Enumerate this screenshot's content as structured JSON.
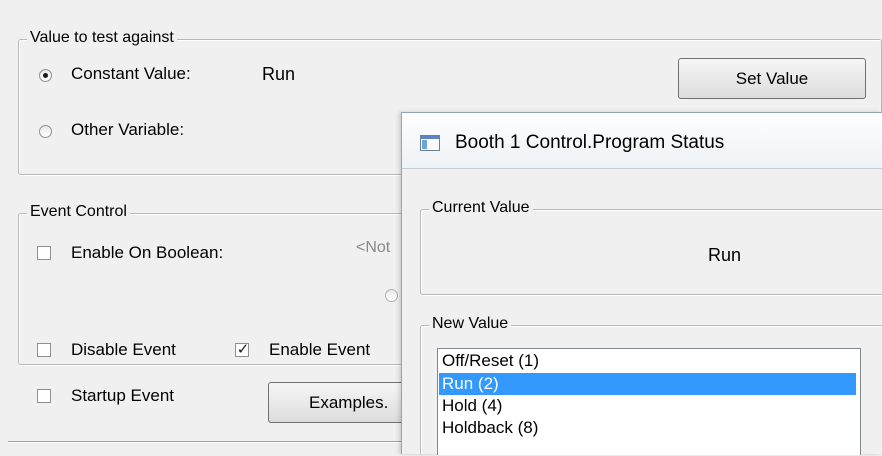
{
  "test_group": {
    "legend": "Value to test against",
    "constant_label": "Constant Value:",
    "constant_value": "Run",
    "other_label": "Other Variable:",
    "set_value_button": "Set Value"
  },
  "event_group": {
    "legend": "Event Control",
    "enable_on_boolean_label": "Enable On Boolean:",
    "not_text": "<Not",
    "disable_event_label": "Disable Event",
    "enable_event_label": "Enable Event",
    "enable_event_checked": true
  },
  "startup_event_label": "Startup Event",
  "examples_button": "Examples.",
  "dialog": {
    "title": "Booth 1 Control.Program Status",
    "current_value_legend": "Current Value",
    "current_value": "Run",
    "new_value_legend": "New Value",
    "options": [
      "Off/Reset (1)",
      "Run (2)",
      "Hold (4)",
      "Holdback (8)"
    ],
    "selected_index": 1,
    "selection_color": "#3399ff"
  }
}
